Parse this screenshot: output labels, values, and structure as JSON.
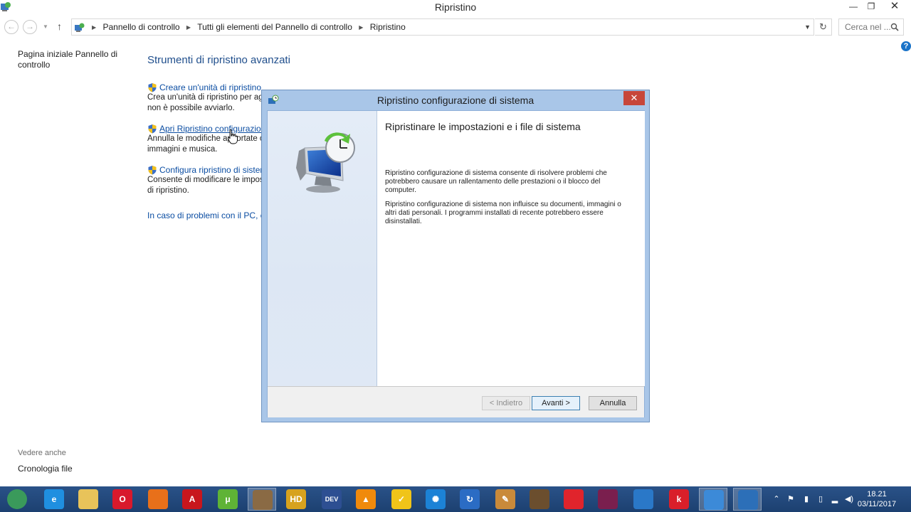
{
  "window": {
    "title": "Ripristino",
    "minimize": "—",
    "maximize": "❐",
    "close": "✕"
  },
  "nav": {
    "back": "←",
    "forward": "→",
    "up": "↑",
    "breadcrumbs": [
      "Pannello di controllo",
      "Tutti gli elementi del Pannello di controllo",
      "Ripristino"
    ],
    "refresh": "↻",
    "search_placeholder": "Cerca nel ..."
  },
  "help": "?",
  "sidebar": {
    "home_link": "Pagina iniziale Pannello di controllo",
    "see_also": "Vedere anche",
    "file_history": "Cronologia file"
  },
  "main": {
    "title": "Strumenti di ripristino avanzati",
    "tools": [
      {
        "label": "Creare un'unità di ripristino",
        "desc1": "Crea un'unità di ripristino per ag",
        "desc2": "non è possibile avviarlo."
      },
      {
        "label": "Apri Ripristino configurazione",
        "desc1": "Annulla le modifiche apportate c",
        "desc2": "immagini e musica."
      },
      {
        "label": "Configura ripristino di sistema",
        "desc1": "Consente di modificare le impos",
        "desc2": "di ripristino."
      }
    ],
    "problem_link": "In caso di problemi con il PC, è p"
  },
  "dialog": {
    "title": "Ripristino configurazione di sistema",
    "close": "✕",
    "heading": "Ripristinare le impostazioni e i file di sistema",
    "para1": "Ripristino configurazione di sistema consente di risolvere problemi che potrebbero causare un rallentamento delle prestazioni o il blocco del computer.",
    "para2": "Ripristino configurazione di sistema non influisce su documenti, immagini o altri dati personali. I programmi installati di recente potrebbero essere disinstallati.",
    "back_button": "< Indietro",
    "next_button": "Avanti >",
    "cancel_button": "Annulla"
  },
  "taskbar": {
    "apps": [
      {
        "name": "start-orb-icon",
        "color": "#3a9a5b",
        "glyph": ""
      },
      {
        "name": "internet-explorer-icon",
        "color": "#1f8fe0",
        "glyph": "e"
      },
      {
        "name": "file-explorer-icon",
        "color": "#e8c35a",
        "glyph": ""
      },
      {
        "name": "opera-icon",
        "color": "#d8192c",
        "glyph": "O"
      },
      {
        "name": "firefox-icon",
        "color": "#e8701a",
        "glyph": ""
      },
      {
        "name": "acrobat-icon",
        "color": "#c8161d",
        "glyph": "A"
      },
      {
        "name": "utorrent-icon",
        "color": "#5fb336",
        "glyph": "μ"
      },
      {
        "name": "gimp-icon",
        "color": "#8a6a44",
        "glyph": ""
      },
      {
        "name": "hd-app-icon",
        "color": "#d7a21e",
        "glyph": "HD"
      },
      {
        "name": "devcpp-icon",
        "color": "#2d4f92",
        "glyph": "DEV"
      },
      {
        "name": "vlc-icon",
        "color": "#f08a0c",
        "glyph": "▲"
      },
      {
        "name": "checkmark-app-icon",
        "color": "#f0c419",
        "glyph": "✓"
      },
      {
        "name": "gear-badge-app-icon",
        "color": "#1c82d6",
        "glyph": "✺"
      },
      {
        "name": "sync-app-icon",
        "color": "#2b6cc4",
        "glyph": "↻"
      },
      {
        "name": "tools-app-icon",
        "color": "#c98a3a",
        "glyph": "✎"
      },
      {
        "name": "film-app-icon",
        "color": "#6b4e2e",
        "glyph": ""
      },
      {
        "name": "red-app-icon",
        "color": "#e0242c",
        "glyph": ""
      },
      {
        "name": "winrar-icon",
        "color": "#7a1f4e",
        "glyph": ""
      },
      {
        "name": "network-app-icon",
        "color": "#2a78c8",
        "glyph": ""
      },
      {
        "name": "k-app-icon",
        "color": "#d91f2a",
        "glyph": "k"
      },
      {
        "name": "control-panel-icon",
        "color": "#3c8ad8",
        "glyph": ""
      },
      {
        "name": "system-restore-icon",
        "color": "#2c6fb8",
        "glyph": ""
      }
    ],
    "tray_up": "⌃",
    "tray_flag": "⚑",
    "tray_usb": "▮",
    "tray_battery": "▯",
    "tray_network": "▂",
    "tray_volume": "◀)",
    "time": "18.21",
    "date": "03/11/2017"
  }
}
